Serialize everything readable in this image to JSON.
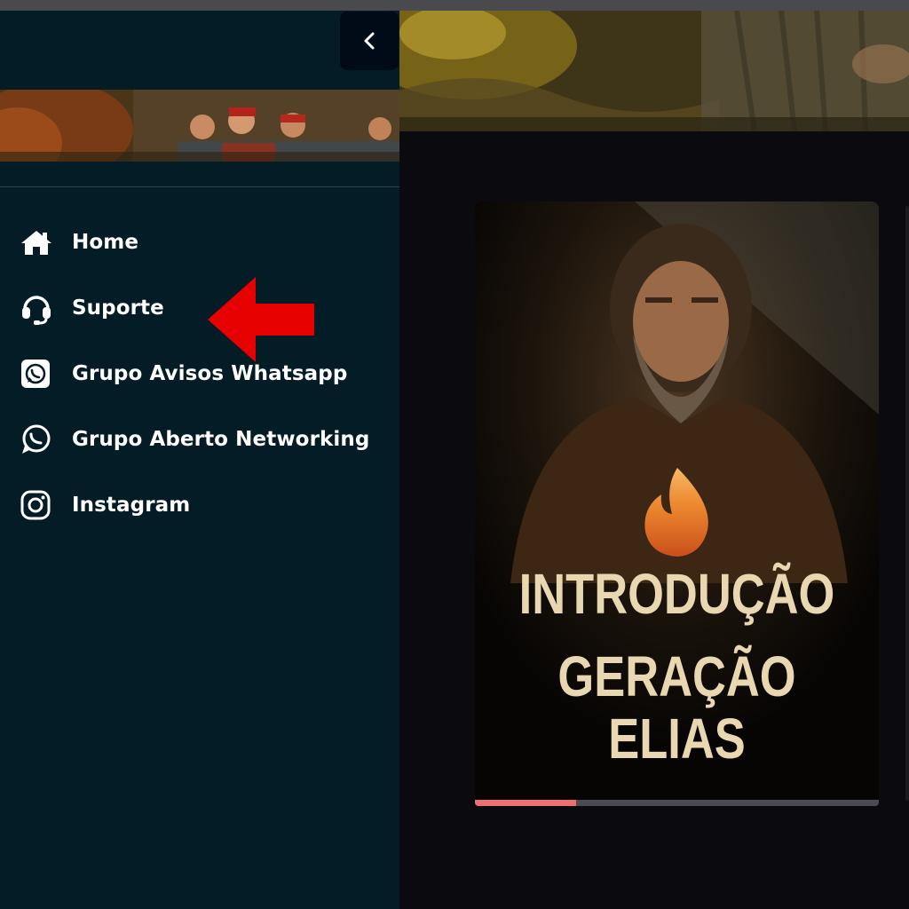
{
  "sidebar": {
    "items": [
      {
        "label": "Home",
        "icon": "home-icon"
      },
      {
        "label": "Suporte",
        "icon": "headset-icon"
      },
      {
        "label": "Grupo Avisos Whatsapp",
        "icon": "whatsapp-square-icon"
      },
      {
        "label": "Grupo Aberto Networking",
        "icon": "whatsapp-icon"
      },
      {
        "label": "Instagram",
        "icon": "instagram-icon"
      }
    ],
    "collapse_icon": "chevron-left-icon"
  },
  "main": {
    "card": {
      "title_line1": "INTRODUÇÃO",
      "title_line2": "GERAÇÃO",
      "title_line3": "ELIAS",
      "progress": 0.25
    }
  },
  "colors": {
    "sidebar_bg": "#031c26",
    "main_bg": "#0b0b0f",
    "progress_fill": "#ef6f6f",
    "progress_track": "#4b4b55",
    "title_text": "#e8d7b0",
    "arrow": "#e60000"
  }
}
